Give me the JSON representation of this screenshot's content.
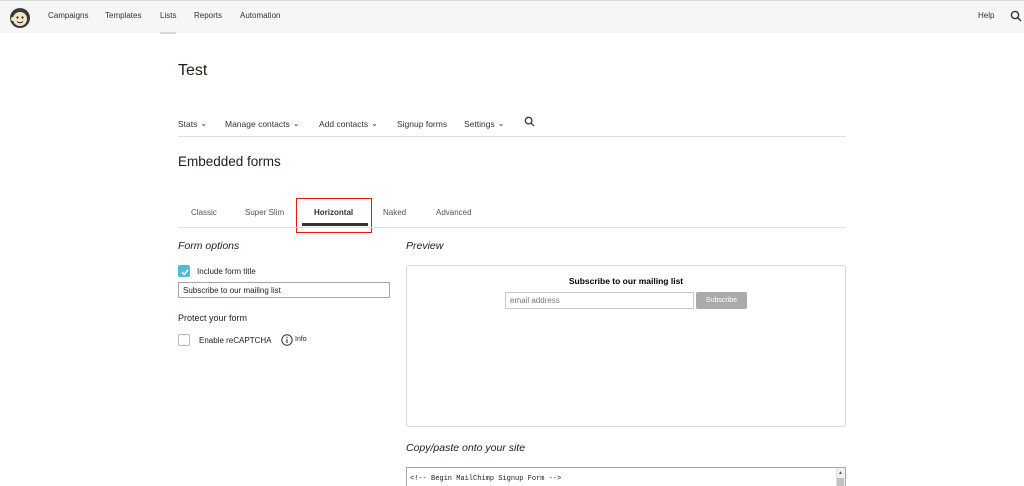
{
  "topnav": {
    "items": [
      {
        "label": "Campaigns"
      },
      {
        "label": "Templates"
      },
      {
        "label": "Lists"
      },
      {
        "label": "Reports"
      },
      {
        "label": "Automation"
      }
    ],
    "active_item": "Lists",
    "help_label": "Help",
    "logo_icon": "mailchimp-freddie-logo",
    "search_icon": "search-icon"
  },
  "page": {
    "title": "Test"
  },
  "subnav": {
    "items": [
      {
        "label": "Stats",
        "has_dropdown": true
      },
      {
        "label": "Manage contacts",
        "has_dropdown": true
      },
      {
        "label": "Add contacts",
        "has_dropdown": true
      },
      {
        "label": "Signup forms",
        "has_dropdown": false
      },
      {
        "label": "Settings",
        "has_dropdown": true
      }
    ],
    "search_icon": "search-icon"
  },
  "section": {
    "title": "Embedded forms"
  },
  "tabs": {
    "items": [
      {
        "label": "Classic"
      },
      {
        "label": "Super Slim"
      },
      {
        "label": "Horizontal"
      },
      {
        "label": "Naked"
      },
      {
        "label": "Advanced"
      }
    ],
    "active": "Horizontal",
    "highlight_color": "#e41b1b"
  },
  "form_options": {
    "heading": "Form options",
    "include_title": {
      "label": "Include form title",
      "checked": true
    },
    "title_value": "Subscribe to our mailing list",
    "protect_heading": "Protect your form",
    "recaptcha": {
      "label": "Enable reCAPTCHA",
      "checked": false
    },
    "info_label": "Info",
    "checkbox_color": "#52bad5"
  },
  "preview": {
    "heading": "Preview",
    "title": "Subscribe to our mailing list",
    "email_placeholder": "email address",
    "subscribe_label": "Subscribe"
  },
  "copy_paste": {
    "heading": "Copy/paste onto your site",
    "code_first_line": "<!-- Begin MailChimp Signup Form -->"
  }
}
